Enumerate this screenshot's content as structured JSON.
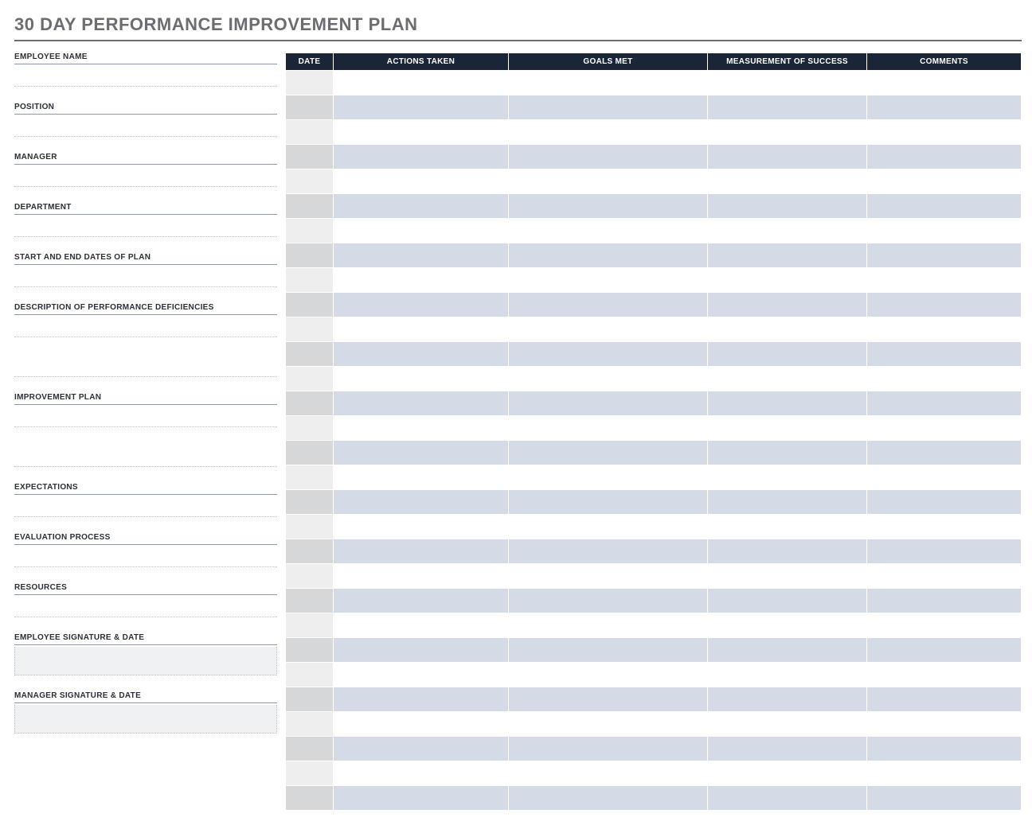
{
  "title": "30 DAY PERFORMANCE IMPROVEMENT PLAN",
  "left_fields": [
    {
      "label": "EMPLOYEE NAME",
      "lines": 1
    },
    {
      "label": "POSITION",
      "lines": 1
    },
    {
      "label": "MANAGER",
      "lines": 1
    },
    {
      "label": "DEPARTMENT",
      "lines": 1
    },
    {
      "label": "START AND END DATES OF PLAN",
      "lines": 1
    },
    {
      "label": "DESCRIPTION OF PERFORMANCE DEFICIENCIES",
      "lines": 2
    },
    {
      "label": "IMPROVEMENT PLAN",
      "lines": 2
    },
    {
      "label": "EXPECTATIONS",
      "lines": 1
    },
    {
      "label": "EVALUATION PROCESS",
      "lines": 1
    },
    {
      "label": "RESOURCES",
      "lines": 1
    }
  ],
  "signatures": [
    {
      "label": "EMPLOYEE SIGNATURE & DATE"
    },
    {
      "label": "MANAGER SIGNATURE & DATE"
    }
  ],
  "table": {
    "headers": {
      "date": "DATE",
      "actions": "ACTIONS TAKEN",
      "goals": "GOALS MET",
      "measure": "MEASUREMENT OF SUCCESS",
      "comments": "COMMENTS"
    },
    "row_count": 30
  }
}
